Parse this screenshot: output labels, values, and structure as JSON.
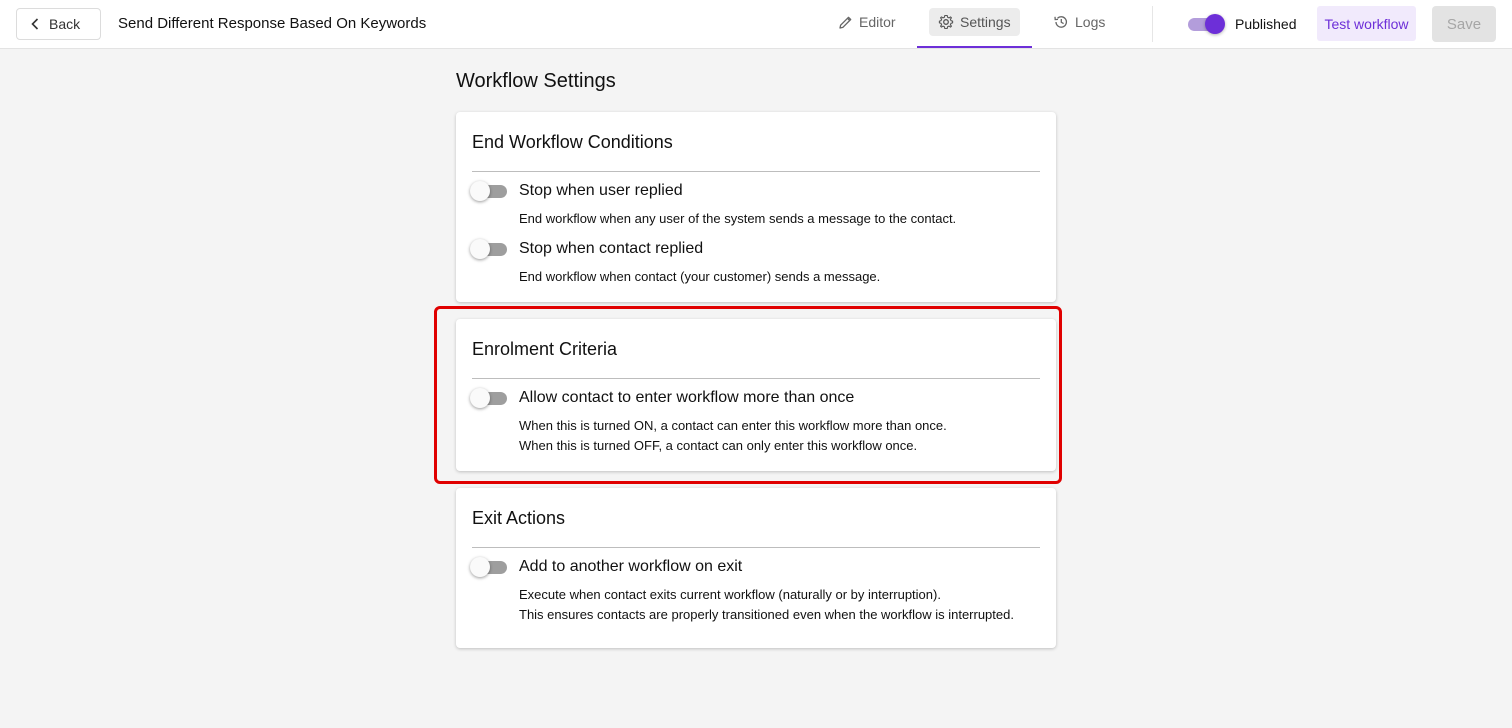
{
  "header": {
    "back_label": "Back",
    "workflow_title": "Send Different Response Based On Keywords",
    "tabs": [
      {
        "label": "Editor",
        "icon": "pencil-icon"
      },
      {
        "label": "Settings",
        "icon": "gear-icon",
        "active": true
      },
      {
        "label": "Logs",
        "icon": "history-icon"
      }
    ],
    "published_label": "Published",
    "published_on": true,
    "test_label": "Test workflow",
    "save_label": "Save"
  },
  "page": {
    "heading": "Workflow Settings"
  },
  "sections": [
    {
      "title": "End Workflow Conditions",
      "options": [
        {
          "label": "Stop when user replied",
          "desc": [
            "End workflow when any user of the system sends a message to the contact."
          ],
          "on": false
        },
        {
          "label": "Stop when contact replied",
          "desc": [
            "End workflow when contact (your customer) sends a message."
          ],
          "on": false
        }
      ]
    },
    {
      "title": "Enrolment Criteria",
      "options": [
        {
          "label": "Allow contact to enter workflow more than once",
          "desc": [
            "When this is turned ON, a contact can enter this workflow more than once.",
            "When this is turned OFF, a contact can only enter this workflow once."
          ],
          "on": false
        }
      ]
    },
    {
      "title": "Exit Actions",
      "options": [
        {
          "label": "Add to another workflow on exit",
          "desc": [
            "Execute when contact exits current workflow (naturally or by interruption).",
            "This ensures contacts are properly transitioned even when the workflow is interrupted."
          ],
          "on": false
        }
      ]
    }
  ],
  "colors": {
    "accent": "#6d2fd8",
    "highlight": "#e00000"
  }
}
